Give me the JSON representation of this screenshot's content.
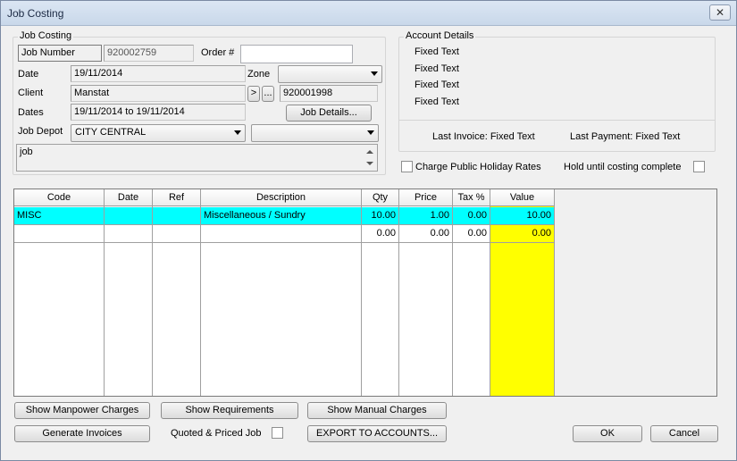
{
  "window": {
    "title": "Job Costing",
    "close_label": "✕"
  },
  "job_costing": {
    "group_title": "Job Costing",
    "job_number_label": "Job Number",
    "job_number_value": "920002759",
    "order_label": "Order #",
    "order_value": "",
    "date_label": "Date",
    "date_value": "19/11/2014",
    "zone_label": "Zone",
    "zone_value": "",
    "client_label": "Client",
    "client_value": "Manstat",
    "client_nav_label": ">",
    "client_browse_label": "...",
    "client_code": "920001998",
    "dates_label": "Dates",
    "dates_value": "19/11/2014 to 19/11/2014",
    "job_details_button": "Job Details...",
    "job_depot_label": "Job Depot",
    "job_depot_value": "CITY CENTRAL",
    "job_depot_secondary_value": "",
    "notes_value": "job"
  },
  "account_details": {
    "group_title": "Account Details",
    "lines": [
      "Fixed Text",
      "Fixed Text",
      "Fixed Text",
      "Fixed Text"
    ],
    "last_invoice": "Last Invoice: Fixed Text",
    "last_payment": "Last Payment: Fixed Text"
  },
  "options": {
    "charge_public_holiday_label": "Charge Public Holiday Rates",
    "charge_public_holiday_checked": false,
    "hold_until_costing_label": "Hold until costing complete",
    "hold_until_costing_checked": false,
    "quoted_priced_label": "Quoted & Priced Job",
    "quoted_priced_checked": false
  },
  "grid": {
    "columns": [
      "Code",
      "Date",
      "Ref",
      "Description",
      "Qty",
      "Price",
      "Tax %",
      "Value"
    ],
    "rows": [
      {
        "code": "MISC",
        "date": "",
        "ref": "",
        "description": "Miscellaneous / Sundry",
        "qty": "10.00",
        "price": "1.00",
        "tax": "0.00",
        "value": "10.00"
      },
      {
        "code": "",
        "date": "",
        "ref": "",
        "description": "",
        "qty": "0.00",
        "price": "0.00",
        "tax": "0.00",
        "value": "0.00"
      }
    ],
    "colors": {
      "selected_row": "#00ffff",
      "value_column": "#ffff00"
    }
  },
  "buttons": {
    "show_manpower": "Show Manpower Charges",
    "show_requirements": "Show Requirements",
    "show_manual": "Show Manual Charges",
    "generate_invoices": "Generate Invoices",
    "export_to_accounts": "EXPORT TO ACCOUNTS...",
    "ok": "OK",
    "cancel": "Cancel"
  }
}
